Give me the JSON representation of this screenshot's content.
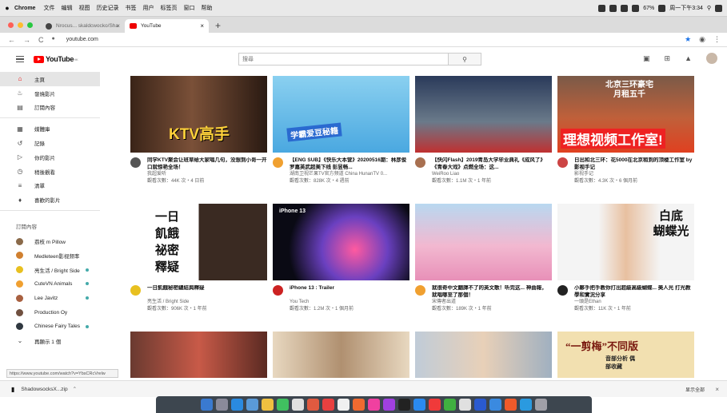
{
  "menubar": {
    "app": "Chrome",
    "items": [
      "文件",
      "编辑",
      "视图",
      "历史记录",
      "书签",
      "用户",
      "标签页",
      "窗口",
      "帮助"
    ],
    "clock": "周一下午3:34",
    "battery": "67%"
  },
  "tabs": [
    {
      "title": "Nrocus... skaldcwocko/Sha"
    },
    {
      "title": "YouTube"
    }
  ],
  "address": {
    "url": "youtube.com"
  },
  "youtube": {
    "logo": "YouTube",
    "logo_sup": "HK",
    "search_placeholder": "搜尋"
  },
  "sidebar": {
    "main": [
      {
        "label": "主頁",
        "icon": "home-icon"
      },
      {
        "label": "發燒影片",
        "icon": "flame-icon"
      },
      {
        "label": "訂閱內容",
        "icon": "subscriptions-icon"
      }
    ],
    "library": [
      {
        "label": "媒體庫",
        "icon": "library-icon"
      },
      {
        "label": "記錄",
        "icon": "history-icon"
      },
      {
        "label": "你的影片",
        "icon": "video-icon"
      },
      {
        "label": "稍後觀看",
        "icon": "clock-icon"
      },
      {
        "label": "清單",
        "icon": "playlist-icon"
      },
      {
        "label": "喜歡的影片",
        "icon": "thumbs-up-icon"
      }
    ],
    "subs_heading": "訂閱內容",
    "subs": [
      {
        "label": "荔枝 m Pillow",
        "color": "#8a6a4a"
      },
      {
        "label": "Medleteen影视频率",
        "color": "#d08030"
      },
      {
        "label": "亮生活 / Bright Side",
        "color": "#e8c020"
      },
      {
        "label": "CuteVN Animals",
        "color": "#f0a030"
      },
      {
        "label": "Lee Javitz",
        "color": "#a86040"
      },
      {
        "label": "Production Oy",
        "color": "#705040"
      },
      {
        "label": "Chinese Fairy Tales",
        "color": "#303840"
      }
    ],
    "show_more": "再顯示 1 個"
  },
  "videos": [
    {
      "thumb_text": "KTV高手",
      "title": "同学KTV聚会让班草给大家唱几句，没想到小哥一开口就惊艳全场！",
      "channel": "我超爱听",
      "views": "觀看次數：44K 次・4 日前",
      "bg": "#5a3a28",
      "av": "#555"
    },
    {
      "thumb_text": "学霸爱豆秘籍",
      "title": "【ENG SUB】《快乐大本营》20200516期：林彦俊罗嘉英武超美下线 彭昱畅...",
      "channel": "湖南卫视芒果TV官方频道 China HunanTV 0...",
      "views": "觀看次數：828K 次・4 週前",
      "bg": "#6fc0e8",
      "av": "#f0a030"
    },
    {
      "thumb_text": "",
      "title": "【快闪Flash】2019青岛大学毕业典礼《成风了》《青春大戏》点燃全场：这...",
      "channel": "WeiRoo Liao",
      "views": "觀看次數：1.1M 次・1 年前",
      "bg": "#2a3a5a",
      "av": "#a87050"
    },
    {
      "thumb_text": "理想视频工作室!",
      "thumb_top": "北京三环豪宅 月租五千",
      "title": "日出和北三环：花5000在北京租到的顶楼工作室 by 影视手记",
      "channel": "影视手记",
      "views": "觀看次數：4.3K 次・6 個月前",
      "bg": "#e04020",
      "av": "#c44"
    },
    {
      "thumb_text": "一日 飢餓 祕密 釋疑",
      "title": "一日飢餓秘密總結與釋疑",
      "channel": "亮生活 / Bright Side",
      "views": "觀看次數：906K 次・1 年前",
      "bg": "#ffffff",
      "av": "#e8c020"
    },
    {
      "thumb_text": "iPhone 13",
      "title": "iPhone 13 : Trailer",
      "channel": "You Tech",
      "views": "觀看次數：1.2M 次・1 個月前",
      "bg": "#0a0a14",
      "av": "#c22"
    },
    {
      "thumb_text": "",
      "title": "就很奇中文翻譯不了的英文歌！听完这...  神曲報，就唱哪至了那個！",
      "channel": "宋傳者出道",
      "views": "觀看次數：189K 次・1 年前",
      "bg": "#f2b8d0",
      "av": "#f0a030"
    },
    {
      "thumb_text": "白底 蝴蝶光",
      "title": "小夥手把手教你打出超級高級蝴蝶... 美人光 打光教學和實況分享",
      "channel": "一頭是Ethan",
      "views": "觀看次數：11K 次・1 年前",
      "bg": "#f8f8f8",
      "av": "#222"
    },
    {
      "thumb_text": "",
      "title": "",
      "channel": "",
      "views": "",
      "bg": "#b44a3a",
      "av": "#888"
    },
    {
      "thumb_text": "",
      "title": "",
      "channel": "",
      "views": "",
      "bg": "#d8c4a8",
      "av": "#888"
    },
    {
      "thumb_text": "",
      "title": "",
      "channel": "",
      "views": "",
      "bg": "#d0d8e0",
      "av": "#888"
    },
    {
      "thumb_text": "“一剪梅”不同版",
      "thumb_sub": "音部分析 偶部收藏",
      "title": "",
      "channel": "",
      "views": "",
      "bg": "#f2e0b0",
      "av": "#888"
    }
  ],
  "status_url": "https://www.youtube.com/watch?v=YbsCRcVrelw",
  "downloads": {
    "file": "ShadowsocksX...zip",
    "show_all": "显示全部"
  }
}
